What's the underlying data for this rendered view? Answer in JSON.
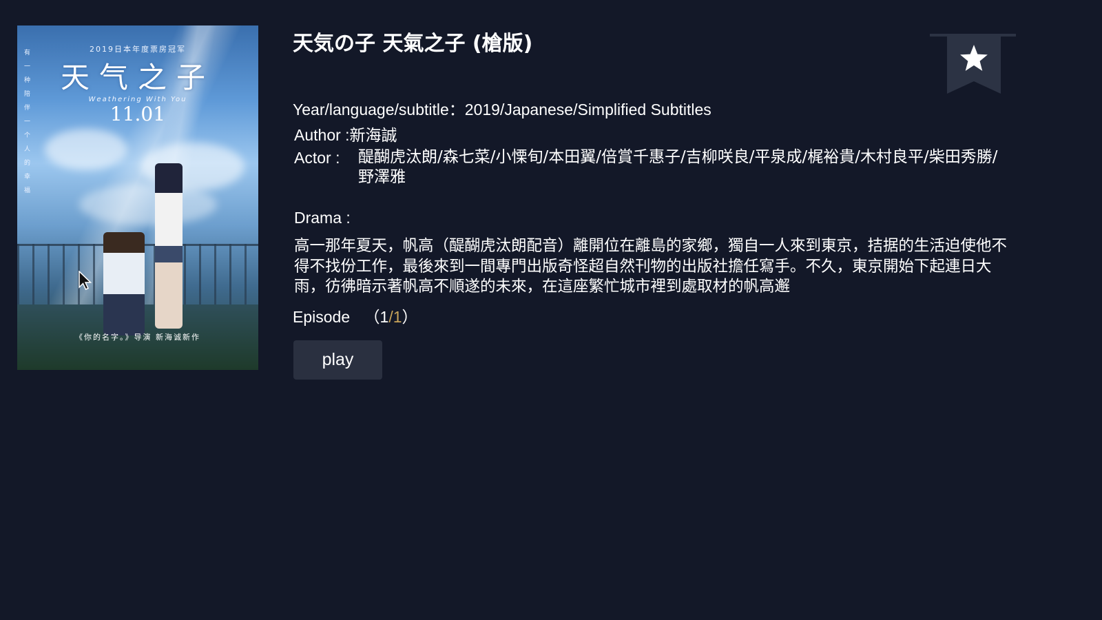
{
  "poster": {
    "top_text": "2019日本年度票房冠军",
    "title": "天气之子",
    "subtitle_en": "Weathering With You",
    "date": "11.01",
    "vertical_text": "有一种陪伴一个人的幸福",
    "caption": "《你的名字。》导演 新海诚新作"
  },
  "movie": {
    "title": "天気の子 天氣之子 (槍版)",
    "year_label": "Year/language/subtitle：",
    "year_value": "2019/Japanese/Simplified Subtitles",
    "author_label": "Author :",
    "author_value": "新海誠",
    "actor_label": "Actor :",
    "actor_value": "醍醐虎汰朗/森七菜/小慄旬/本田翼/倍賞千惠子/吉柳咲良/平泉成/梶裕貴/木村良平/柴田秀勝/野澤雅",
    "drama_label": "Drama :",
    "drama_text": "高一那年夏天，帆高（醍醐虎汰朗配音）離開位在離島的家鄉，獨自一人來到東京，拮据的生活迫使他不得不找份工作，最後來到一間專門出版奇怪超自然刊物的出版社擔任寫手。不久，東京開始下起連日大雨，彷彿暗示著帆高不順遂的未來，在這座繁忙城市裡到處取材的帆高邂",
    "episode_label": "Episode",
    "episode_open": "（",
    "episode_current": "1",
    "episode_sep": "/",
    "episode_total": "1",
    "episode_close": "）"
  },
  "actions": {
    "play_label": "play",
    "favorite_icon": "star-icon"
  },
  "colors": {
    "background": "#131828",
    "button_bg": "#2a3040",
    "ribbon": "#2c3344",
    "episode_total": "#c9a45a"
  }
}
